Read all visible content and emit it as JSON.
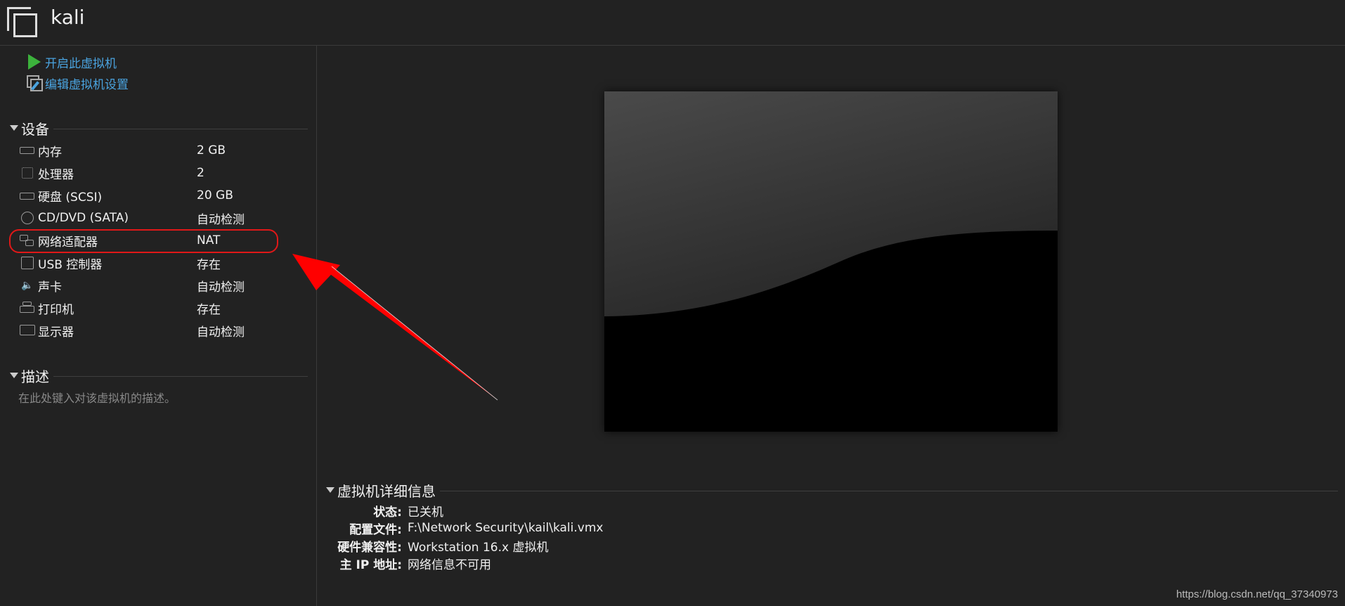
{
  "window": {
    "title": "kali"
  },
  "actions": [
    {
      "label": "开启此虚拟机",
      "icon": "play-icon"
    },
    {
      "label": "编辑虚拟机设置",
      "icon": "edit-settings-icon"
    }
  ],
  "devices": {
    "heading": "设备",
    "items": [
      {
        "name": "内存",
        "value": "2 GB",
        "icon": "memory-icon"
      },
      {
        "name": "处理器",
        "value": "2",
        "icon": "cpu-icon"
      },
      {
        "name": "硬盘 (SCSI)",
        "value": "20 GB",
        "icon": "hard-disk-icon"
      },
      {
        "name": "CD/DVD (SATA)",
        "value": "自动检测",
        "icon": "cd-dvd-icon"
      },
      {
        "name": "网络适配器",
        "value": "NAT",
        "icon": "network-adapter-icon"
      },
      {
        "name": "USB 控制器",
        "value": "存在",
        "icon": "usb-icon"
      },
      {
        "name": "声卡",
        "value": "自动检测",
        "icon": "sound-card-icon"
      },
      {
        "name": "打印机",
        "value": "存在",
        "icon": "printer-icon"
      },
      {
        "name": "显示器",
        "value": "自动检测",
        "icon": "display-icon"
      }
    ]
  },
  "description": {
    "heading": "描述",
    "placeholder": "在此处键入对该虚拟机的描述。"
  },
  "details": {
    "heading": "虚拟机详细信息",
    "rows": [
      {
        "key": "状态:",
        "value": "已关机"
      },
      {
        "key": "配置文件:",
        "value": "F:\\Network Security\\kail\\kali.vmx"
      },
      {
        "key": "硬件兼容性:",
        "value": "Workstation 16.x 虚拟机"
      },
      {
        "key": "主 IP 地址:",
        "value": "网络信息不可用"
      }
    ]
  },
  "annotation": {
    "highlight_color": "#e01818",
    "arrow_color": "#ff0000"
  },
  "watermark": "https://blog.csdn.net/qq_37340973"
}
